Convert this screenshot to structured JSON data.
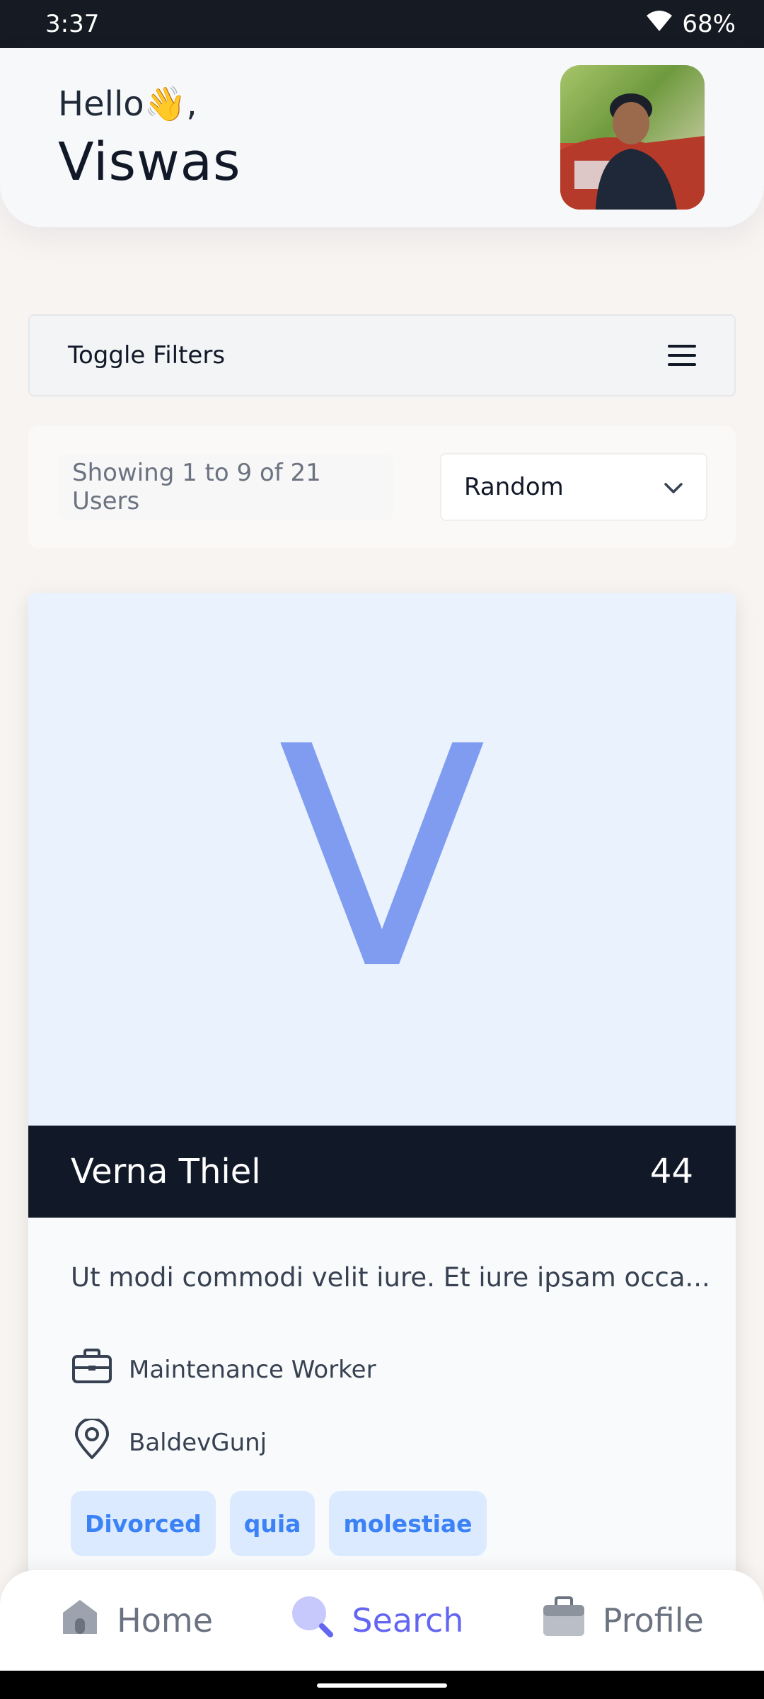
{
  "status_bar": {
    "time": "3:37",
    "battery": "68%"
  },
  "header": {
    "greeting": "Hello👋,",
    "user_name": "Viswas"
  },
  "filters": {
    "toggle_label": "Toggle Filters"
  },
  "results": {
    "count_text": "Showing 1 to 9 of 21 Users",
    "sort_selected": "Random"
  },
  "user_card": {
    "initial": "V",
    "name": "Verna Thiel",
    "age": "44",
    "bio": "Ut modi commodi velit iure. Et iure ipsam occa...",
    "job": "Maintenance Worker",
    "location": "BaldevGunj",
    "tags": [
      "Divorced",
      "quia",
      "molestiae"
    ]
  },
  "bottom_nav": {
    "items": [
      {
        "label": "Home",
        "icon": "home-icon"
      },
      {
        "label": "Search",
        "icon": "search-icon",
        "active": true
      },
      {
        "label": "Profile",
        "icon": "briefcase-icon"
      }
    ]
  },
  "colors": {
    "accent": "#6366f1",
    "tag_text": "#3b82f6",
    "tag_bg": "#dbeafe",
    "name_bar": "#111827",
    "card_image_bg": "#eaf2fe",
    "initial": "#7f9cf0"
  }
}
